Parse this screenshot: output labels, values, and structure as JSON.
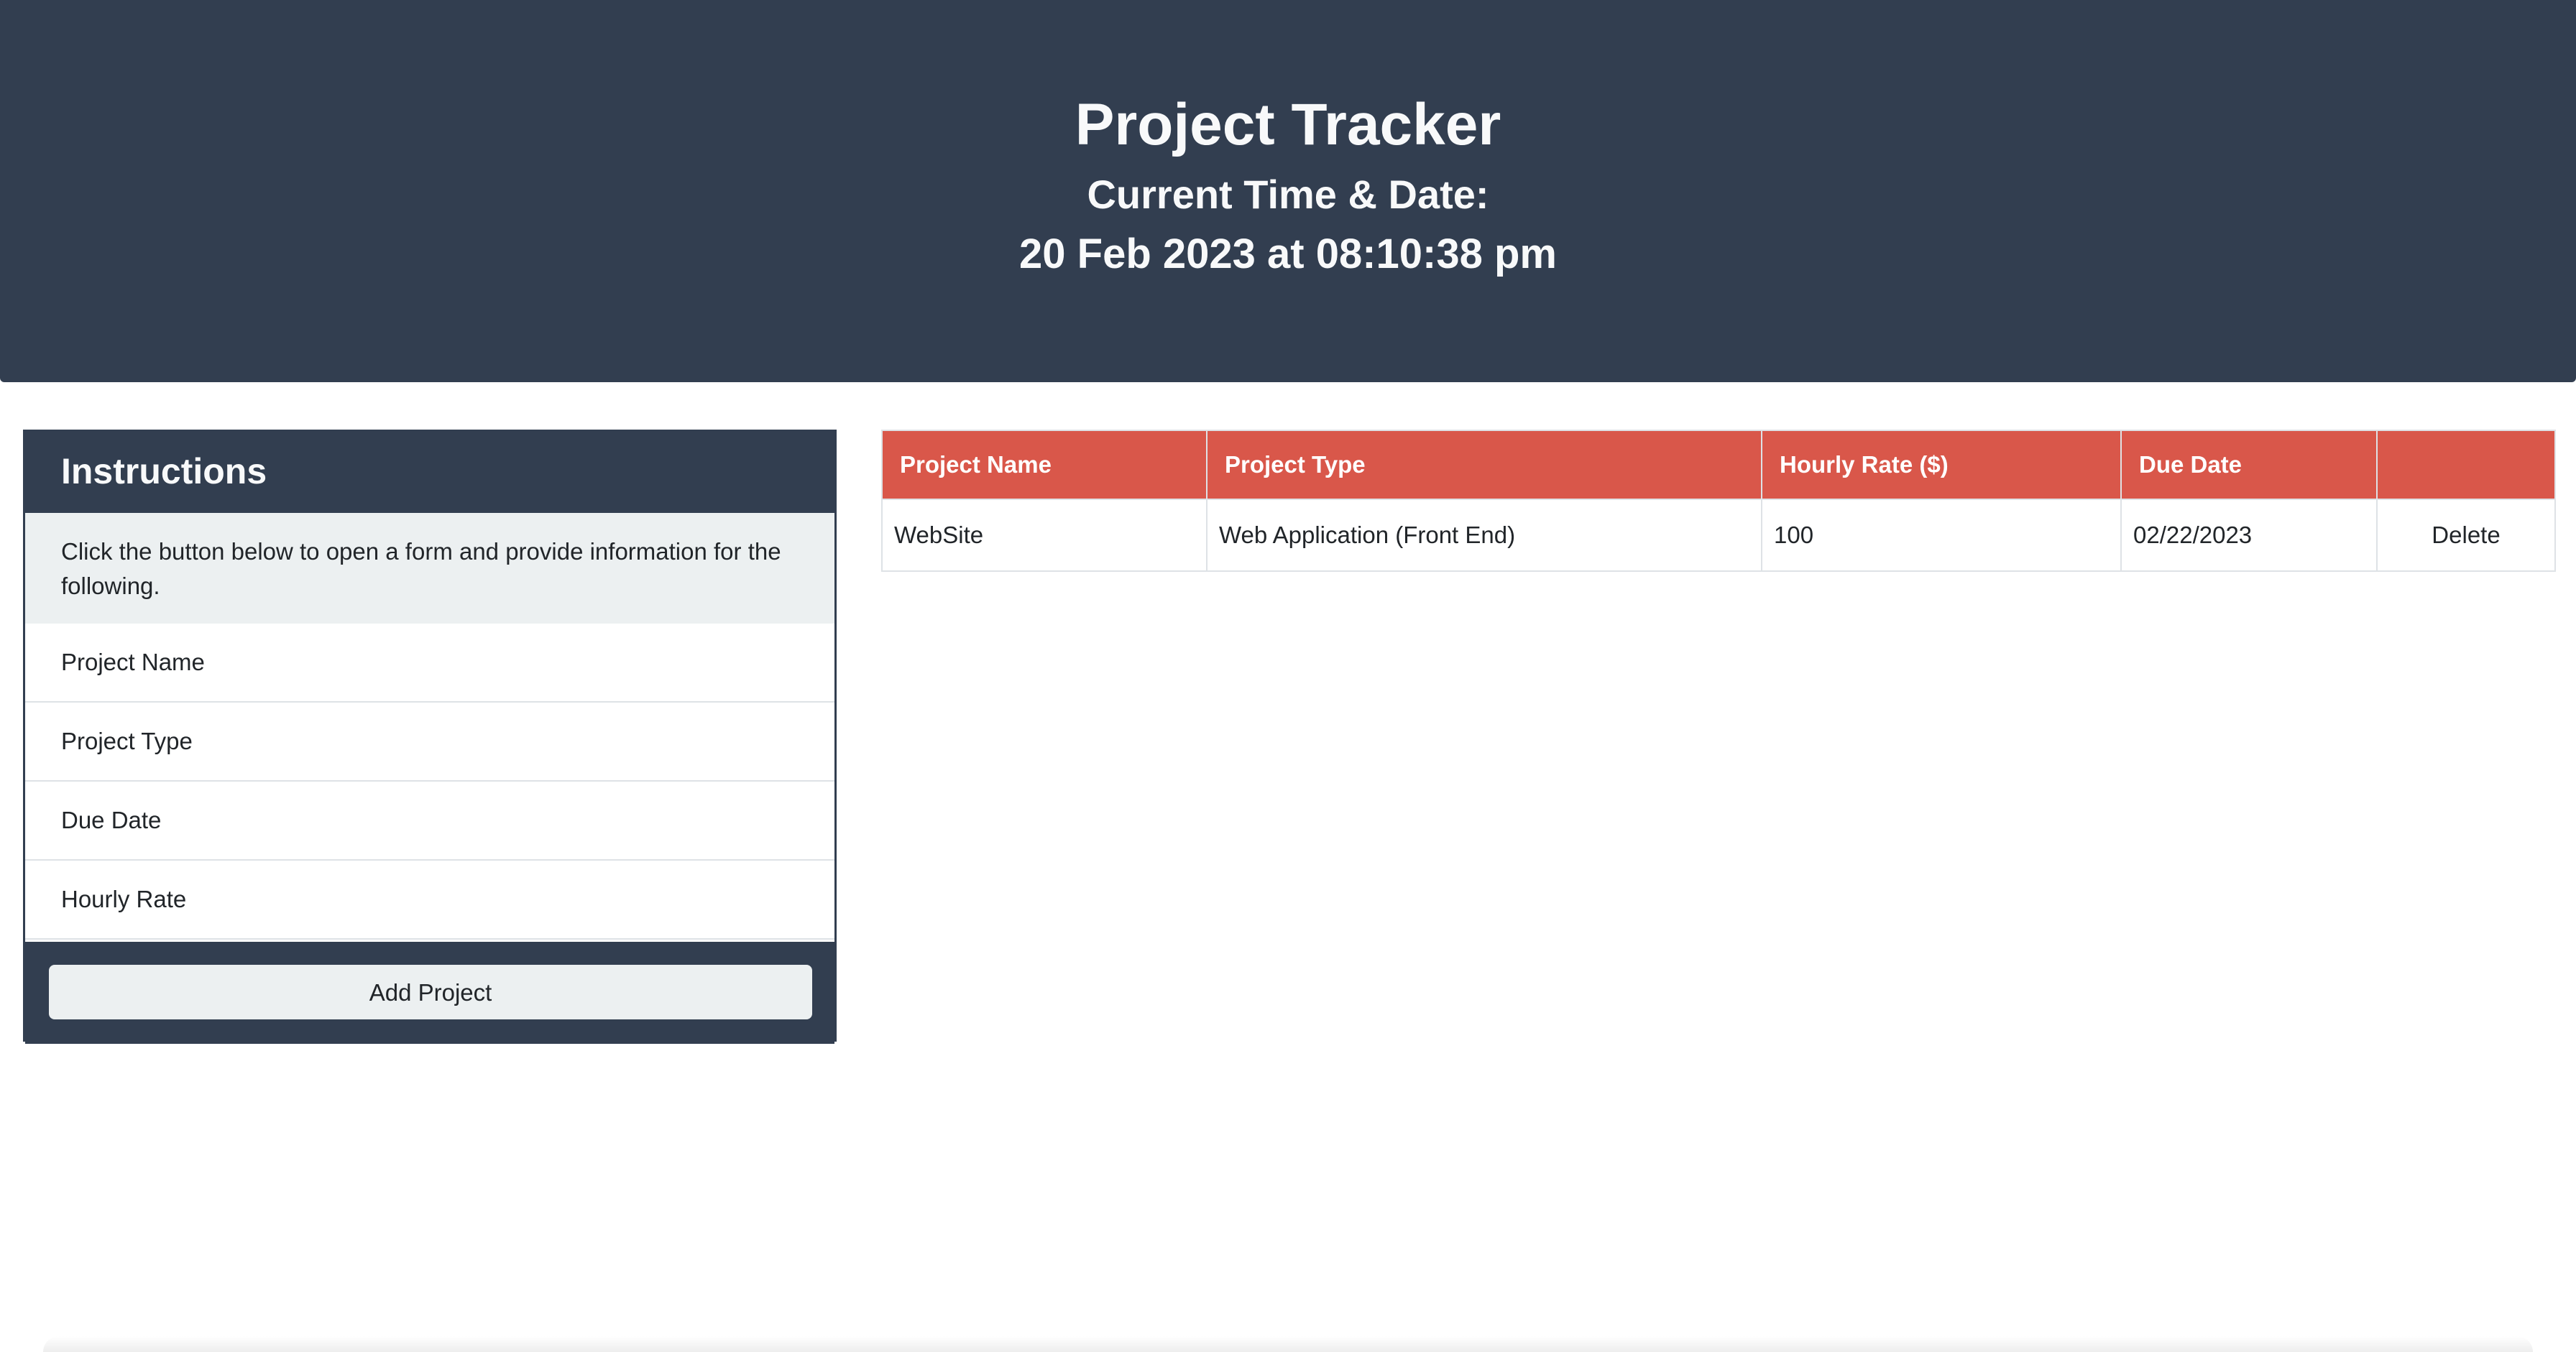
{
  "header": {
    "title": "Project Tracker",
    "subtitle": "Current Time & Date:",
    "datetime": "20 Feb 2023 at 08:10:38 pm",
    "bg_color": "#323e50"
  },
  "instructions": {
    "title": "Instructions",
    "intro": "Click the button below to open a form and provide information for the following.",
    "items": [
      {
        "label": "Project Name"
      },
      {
        "label": "Project Type"
      },
      {
        "label": "Due Date"
      },
      {
        "label": "Hourly Rate"
      }
    ],
    "button_label": "Add Project"
  },
  "table": {
    "header_color": "#d9574a",
    "columns": [
      "Project Name",
      "Project Type",
      "Hourly Rate ($)",
      "Due Date",
      ""
    ],
    "rows": [
      {
        "project_name": "WebSite",
        "project_type": "Web Application (Front End)",
        "hourly_rate": "100",
        "due_date": "02/22/2023",
        "action_label": "Delete"
      }
    ]
  }
}
